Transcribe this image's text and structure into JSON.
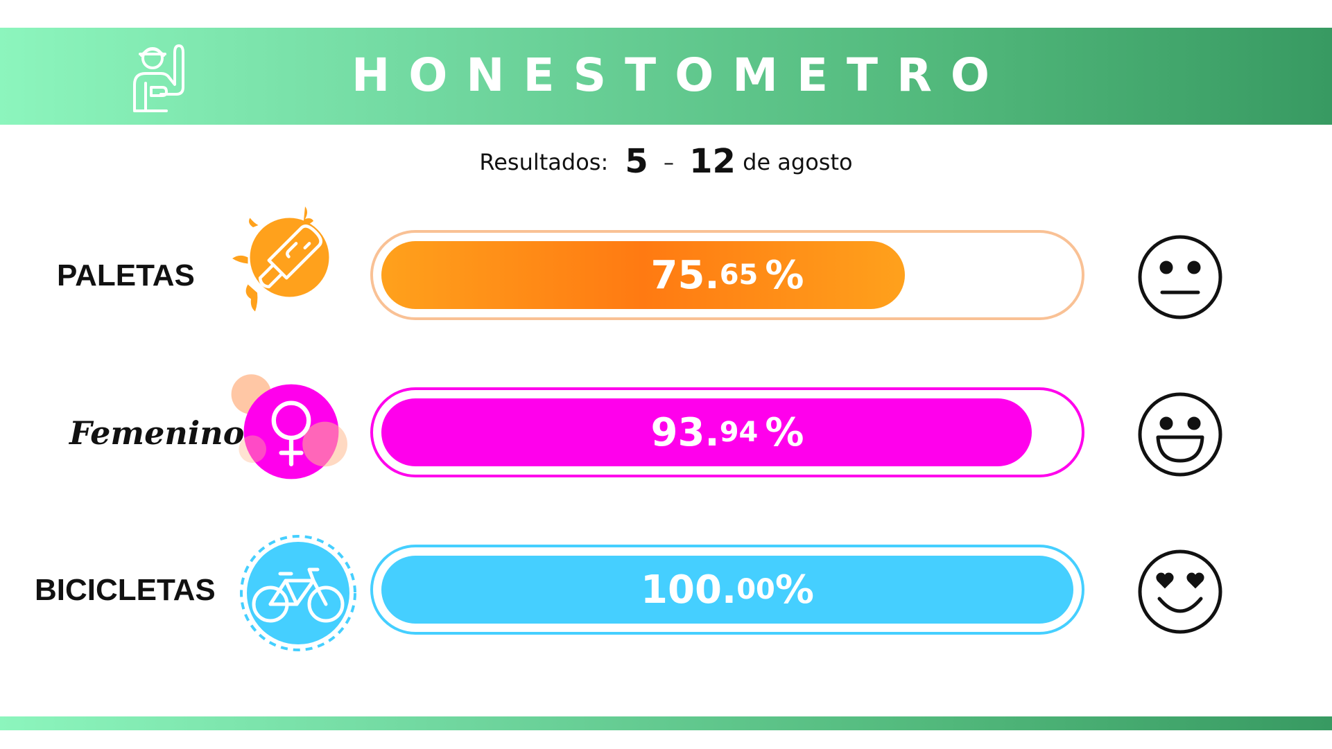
{
  "header": {
    "title": "HONESTOMETRO",
    "icon": "worker-raising-hand-icon"
  },
  "subtitle": {
    "prefix": "Resultados:",
    "start": "5",
    "dash": "–",
    "end": "12",
    "suffix": "de agosto"
  },
  "rows": [
    {
      "label": "PALETAS",
      "icon": "popsicle-icon",
      "value_int": "75.",
      "value_dec": "65",
      "value_pct": "%",
      "value": 75.65,
      "color": "#ffa11c",
      "face": "neutral-face-icon"
    },
    {
      "label": "Femenino",
      "icon": "female-symbol-icon",
      "value_int": "93.",
      "value_dec": "94",
      "value_pct": "%",
      "value": 93.94,
      "color": "#ff00ec",
      "face": "grinning-face-icon"
    },
    {
      "label": "BICICLETAS",
      "icon": "bicycle-icon",
      "value_int": "100.",
      "value_dec": "00",
      "value_pct": "%",
      "value": 100.0,
      "color": "#45cfff",
      "face": "heart-eyes-face-icon"
    }
  ]
}
